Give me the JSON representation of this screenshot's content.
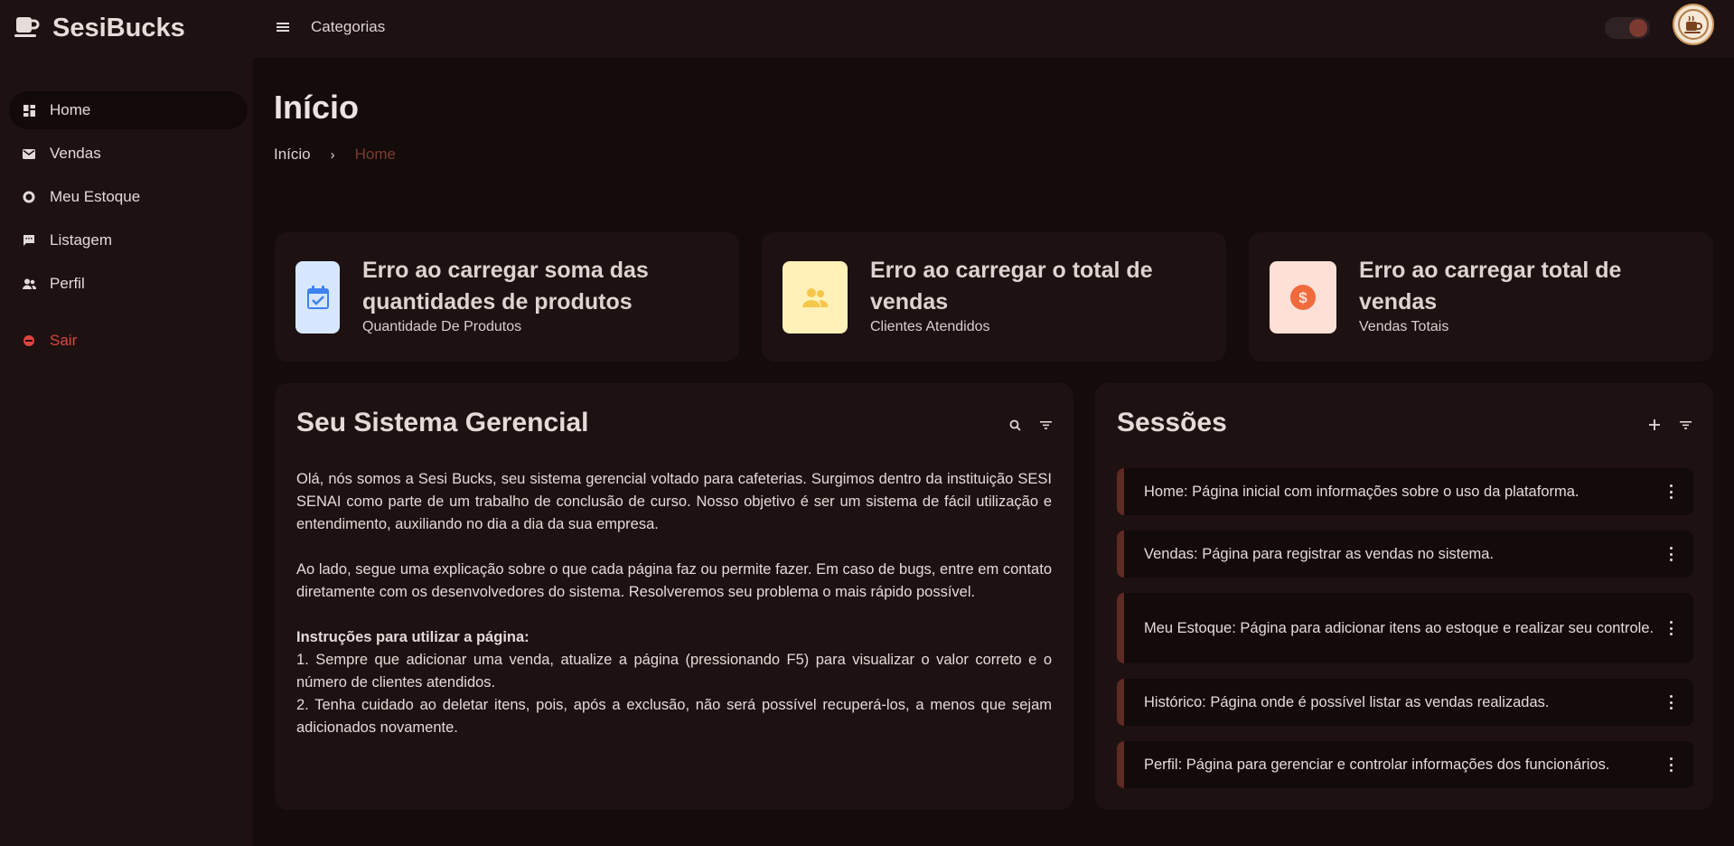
{
  "brand": {
    "name": "SesiBucks",
    "logo_icon": "coffee-cup-icon"
  },
  "topbar": {
    "categories_label": "Categorias",
    "menu_icon": "hamburger-icon",
    "theme_toggle": "dark",
    "avatar_icon": "coffee-logo-avatar"
  },
  "sidebar": {
    "items": [
      {
        "label": "Home",
        "icon": "dashboard-icon",
        "active": true
      },
      {
        "label": "Vendas",
        "icon": "mail-icon"
      },
      {
        "label": "Meu Estoque",
        "icon": "donut-icon"
      },
      {
        "label": "Listagem",
        "icon": "chat-icon"
      },
      {
        "label": "Perfil",
        "icon": "users-icon"
      }
    ],
    "logout": {
      "label": "Sair",
      "icon": "logout-icon"
    }
  },
  "page": {
    "title": "Início",
    "breadcrumb": {
      "root": "Início",
      "separator": "›",
      "current": "Home"
    }
  },
  "stats": [
    {
      "title": "Erro ao carregar soma das quantidades de produtos",
      "subtitle": "Quantidade De Produtos",
      "icon": "calendar-check-icon",
      "bg": "#d6e7ff",
      "fg": "#3c82f0"
    },
    {
      "title": "Erro ao carregar o total de vendas",
      "subtitle": "Clientes Atendidos",
      "icon": "users-icon",
      "bg": "#fff1b8",
      "fg": "#f5c74a"
    },
    {
      "title": "Erro ao carregar total de vendas",
      "subtitle": "Vendas Totais",
      "icon": "dollar-coin-icon",
      "bg": "#ffe0d6",
      "fg": "#f06a3c"
    }
  ],
  "about": {
    "title": "Seu Sistema Gerencial",
    "paragraph1": "Olá, nós somos a Sesi Bucks, seu sistema gerencial voltado para cafeterias. Surgimos dentro da instituição SESI SENAI como parte de um trabalho de conclusão de curso. Nosso objetivo é ser um sistema de fácil utilização e entendimento, auxiliando no dia a dia da sua empresa.",
    "paragraph2": "Ao lado, segue uma explicação sobre o que cada página faz ou permite fazer. Em caso de bugs, entre em contato diretamente com os desenvolvedores do sistema. Resolveremos seu problema o mais rápido possível.",
    "instructions_title": "Instruções para utilizar a página:",
    "instruction1": "1. Sempre que adicionar uma venda, atualize a página (pressionando F5) para visualizar o valor correto e o número de clientes atendidos.",
    "instruction2": "2. Tenha cuidado ao deletar itens, pois, após a exclusão, não será possível recuperá-los, a menos que sejam adicionados novamente."
  },
  "sessions": {
    "title": "Sessões",
    "items": [
      "Home: Página inicial com informações sobre o uso da plataforma.",
      "Vendas: Página para registrar as vendas no sistema.",
      "Meu Estoque: Página para adicionar itens ao estoque e realizar seu controle.",
      "Histórico: Página onde é possível listar as vendas realizadas.",
      "Perfil: Página para gerenciar e controlar informações dos funcionários."
    ]
  }
}
